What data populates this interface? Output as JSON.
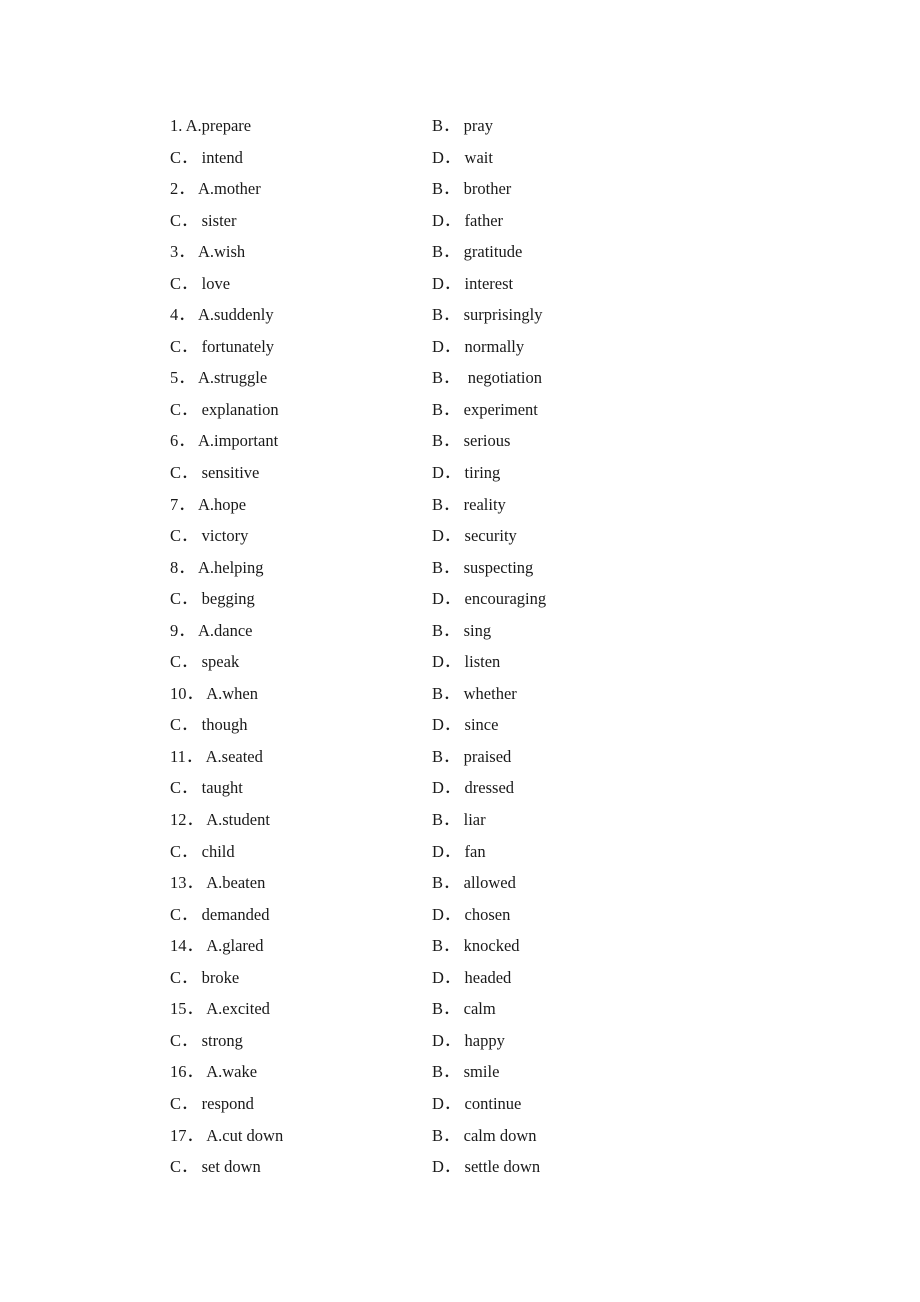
{
  "document": {
    "type": "cloze-test-answer-options",
    "text_color": "#1a1a1a",
    "background_color": "#ffffff"
  },
  "lines": [
    {
      "left_label": "1.",
      "left_text": "A.prepare",
      "right_label": "B．",
      "right_text": "pray"
    },
    {
      "left_label": "C．",
      "left_text": "intend",
      "right_label": "D．",
      "right_text": "wait"
    },
    {
      "left_label": "2．",
      "left_text": "A.mother",
      "right_label": "B．",
      "right_text": "brother"
    },
    {
      "left_label": "C．",
      "left_text": "sister",
      "right_label": "D．",
      "right_text": "father"
    },
    {
      "left_label": "3．",
      "left_text": "A.wish",
      "right_label": "B．",
      "right_text": "gratitude"
    },
    {
      "left_label": "C．",
      "left_text": "love",
      "right_label": "D．",
      "right_text": "interest"
    },
    {
      "left_label": "4．",
      "left_text": "A.suddenly",
      "right_label": "B．",
      "right_text": "surprisingly"
    },
    {
      "left_label": "C．",
      "left_text": "fortunately",
      "right_label": "D．",
      "right_text": "normally"
    },
    {
      "left_label": "5．",
      "left_text": "A.struggle",
      "right_label": "B．",
      "right_text": " negotiation"
    },
    {
      "left_label": "C．",
      "left_text": "explanation",
      "right_label": "B．",
      "right_text": "experiment"
    },
    {
      "left_label": "6．",
      "left_text": "A.important",
      "right_label": "B．",
      "right_text": "serious"
    },
    {
      "left_label": "C．",
      "left_text": "sensitive",
      "right_label": "D．",
      "right_text": "tiring"
    },
    {
      "left_label": "7．",
      "left_text": "A.hope",
      "right_label": "B．",
      "right_text": "reality"
    },
    {
      "left_label": "C．",
      "left_text": "victory",
      "right_label": "D．",
      "right_text": "security"
    },
    {
      "left_label": "8．",
      "left_text": "A.helping",
      "right_label": "B．",
      "right_text": "suspecting"
    },
    {
      "left_label": "C．",
      "left_text": "begging",
      "right_label": "D．",
      "right_text": "encouraging"
    },
    {
      "left_label": "9．",
      "left_text": "A.dance",
      "right_label": "B．",
      "right_text": "sing"
    },
    {
      "left_label": "C．",
      "left_text": "speak",
      "right_label": "D．",
      "right_text": "listen"
    },
    {
      "left_label": "10．",
      "left_text": "A.when",
      "right_label": "B．",
      "right_text": "whether"
    },
    {
      "left_label": "C．",
      "left_text": "though",
      "right_label": "D．",
      "right_text": "since"
    },
    {
      "left_label": "11．",
      "left_text": "A.seated",
      "right_label": "B．",
      "right_text": "praised"
    },
    {
      "left_label": "C．",
      "left_text": "taught",
      "right_label": "D．",
      "right_text": "dressed"
    },
    {
      "left_label": "12．",
      "left_text": "A.student",
      "right_label": "B．",
      "right_text": "liar"
    },
    {
      "left_label": "C．",
      "left_text": "child",
      "right_label": "D．",
      "right_text": "fan"
    },
    {
      "left_label": "13．",
      "left_text": "A.beaten",
      "right_label": "B．",
      "right_text": "allowed"
    },
    {
      "left_label": "C．",
      "left_text": "demanded",
      "right_label": "D．",
      "right_text": "chosen"
    },
    {
      "left_label": "14．",
      "left_text": "A.glared",
      "right_label": "B．",
      "right_text": "knocked"
    },
    {
      "left_label": "C．",
      "left_text": "broke",
      "right_label": "D．",
      "right_text": "headed"
    },
    {
      "left_label": "15．",
      "left_text": "A.excited",
      "right_label": "B．",
      "right_text": "calm"
    },
    {
      "left_label": "C．",
      "left_text": "strong",
      "right_label": "D．",
      "right_text": "happy"
    },
    {
      "left_label": "16．",
      "left_text": "A.wake",
      "right_label": "B．",
      "right_text": "smile"
    },
    {
      "left_label": "C．",
      "left_text": "respond",
      "right_label": "D．",
      "right_text": "continue"
    },
    {
      "left_label": "17．",
      "left_text": "A.cut down",
      "right_label": "B．",
      "right_text": "calm down"
    },
    {
      "left_label": "C．",
      "left_text": "set down",
      "right_label": "D．",
      "right_text": "settle down"
    }
  ]
}
